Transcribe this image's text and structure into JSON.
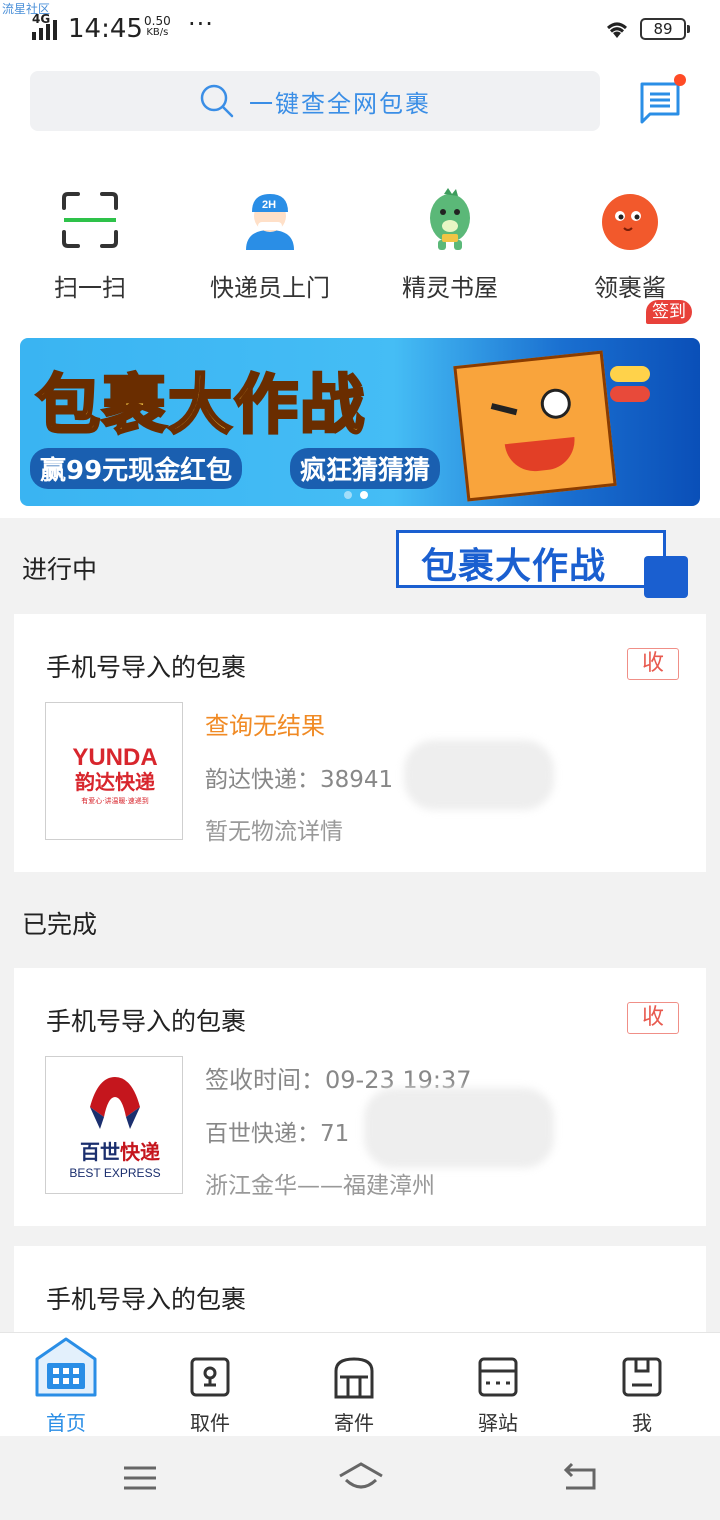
{
  "watermark": "流星社区",
  "status": {
    "network": "4G",
    "time": "14:45",
    "speed_value": "0.50",
    "speed_unit": "KB/s",
    "more": "···",
    "battery": "89"
  },
  "search": {
    "placeholder": "一键查全网包裹"
  },
  "quick_actions": [
    {
      "label": "扫一扫",
      "icon": "scan-icon"
    },
    {
      "label": "快递员上门",
      "icon": "courier-icon",
      "badge": "2H"
    },
    {
      "label": "精灵书屋",
      "icon": "dinosaur-icon"
    },
    {
      "label": "领裹酱",
      "icon": "mascot-icon",
      "badge": "签到"
    }
  ],
  "banner": {
    "title": "包裹大作战",
    "subtitle_left": "赢99元现金红包",
    "subtitle_right": "疯狂猜猜猜"
  },
  "sections": {
    "in_progress": "进行中",
    "completed": "已完成"
  },
  "promo": {
    "text": "包裹大作战"
  },
  "cards": [
    {
      "title": "手机号导入的包裹",
      "action": "收",
      "logo": {
        "brand": "YUNDA",
        "name": "韵达快递",
        "tagline": "有爱心·讲温暖·速递到"
      },
      "status": "查询无结果",
      "status_color": "#f08a24",
      "tracking": "韵达快递：38941",
      "detail": "暂无物流详情"
    },
    {
      "title": "手机号导入的包裹",
      "action": "收",
      "logo": {
        "name_a": "百世",
        "name_b": "快递",
        "en": "BEST EXPRESS"
      },
      "status": "签收时间：09-23 19:37",
      "status_color": "#888888",
      "tracking": "百世快递：71",
      "detail": "浙江金华——福建漳州"
    },
    {
      "title": "手机号导入的包裹"
    }
  ],
  "tabbar": [
    {
      "label": "首页",
      "icon": "home-icon",
      "active": true
    },
    {
      "label": "取件",
      "icon": "pickup-icon"
    },
    {
      "label": "寄件",
      "icon": "send-icon"
    },
    {
      "label": "驿站",
      "icon": "station-icon"
    },
    {
      "label": "我",
      "icon": "profile-icon"
    }
  ],
  "colors": {
    "accent": "#2a8ee6",
    "badge": "#e8413a",
    "promo_blue": "#1a5fd0"
  }
}
